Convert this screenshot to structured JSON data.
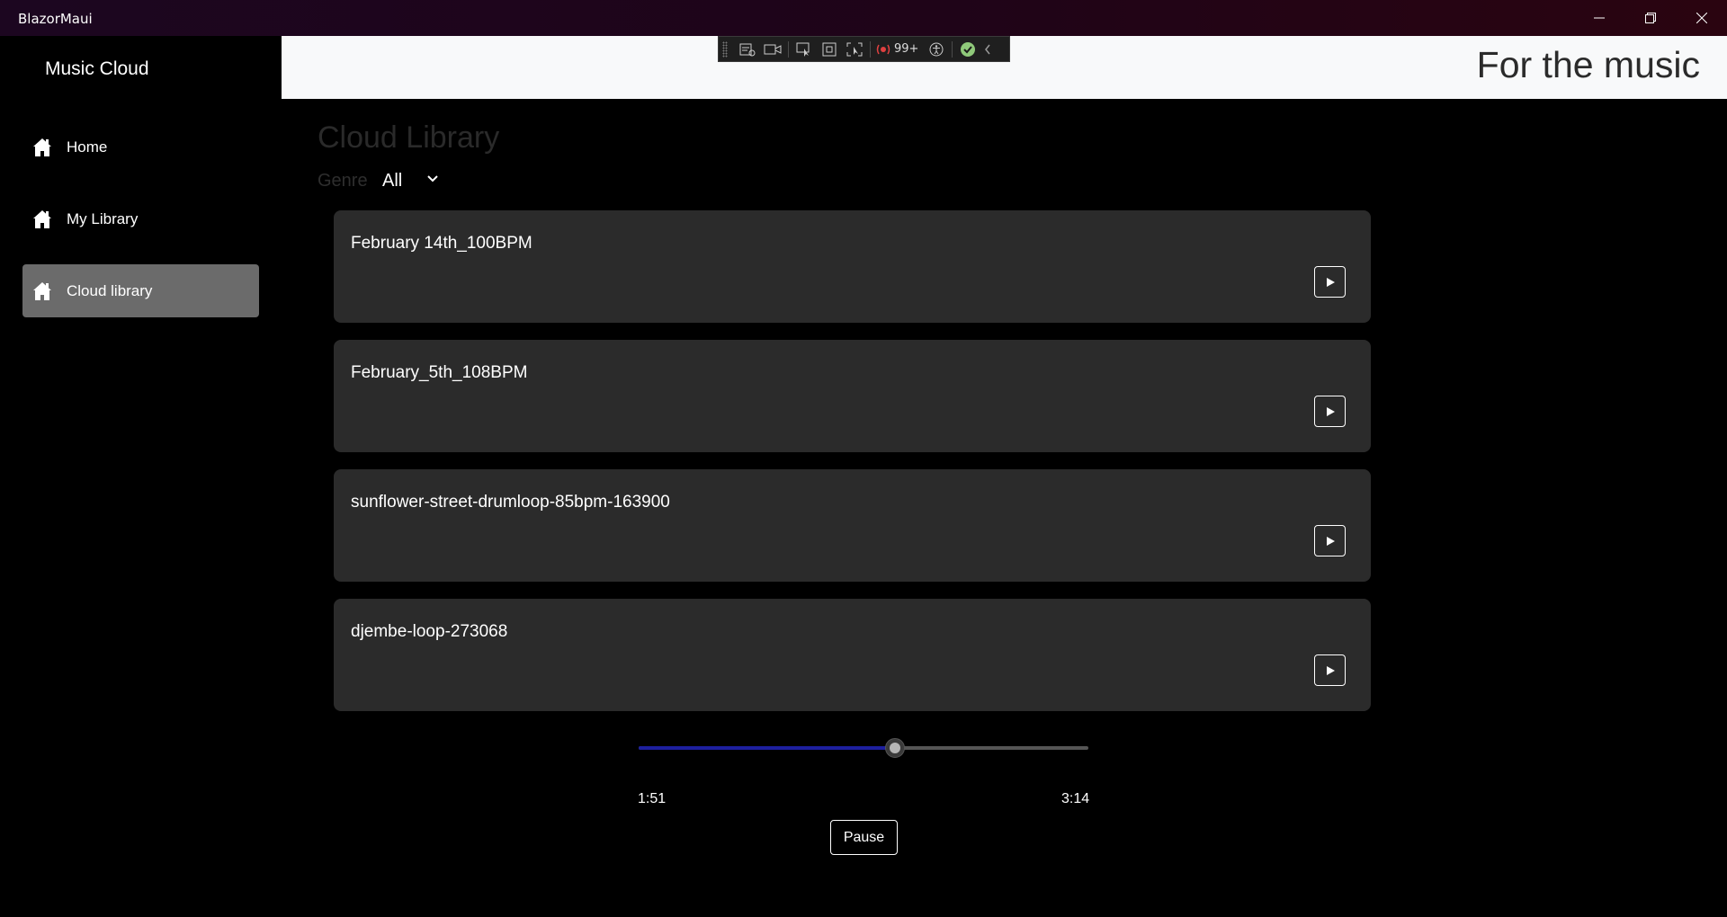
{
  "window": {
    "title": "BlazorMaui"
  },
  "sidebar": {
    "brand": "Music Cloud",
    "items": [
      {
        "label": "Home",
        "icon": "home-icon",
        "active": false
      },
      {
        "label": "My Library",
        "icon": "home-icon",
        "active": false
      },
      {
        "label": "Cloud library",
        "icon": "home-icon",
        "active": true
      }
    ]
  },
  "header": {
    "tagline": "For the music"
  },
  "devtools": {
    "badge_count": "99+"
  },
  "main": {
    "title": "Cloud Library",
    "genre_label": "Genre",
    "genre_value": "All",
    "tracks": [
      {
        "name": "February 14th_100BPM"
      },
      {
        "name": "February_5th_108BPM"
      },
      {
        "name": "sunflower-street-drumloop-85bpm-163900"
      },
      {
        "name": "djembe-loop-273068"
      }
    ]
  },
  "player": {
    "current_time": "1:51",
    "total_time": "3:14",
    "progress_fraction": 0.57,
    "pause_label": "Pause"
  },
  "colors": {
    "accent": "#1d1f9e",
    "card": "#2b2b2b",
    "active_nav": "#6b6b6b",
    "header_bg": "#f8f9fa"
  }
}
